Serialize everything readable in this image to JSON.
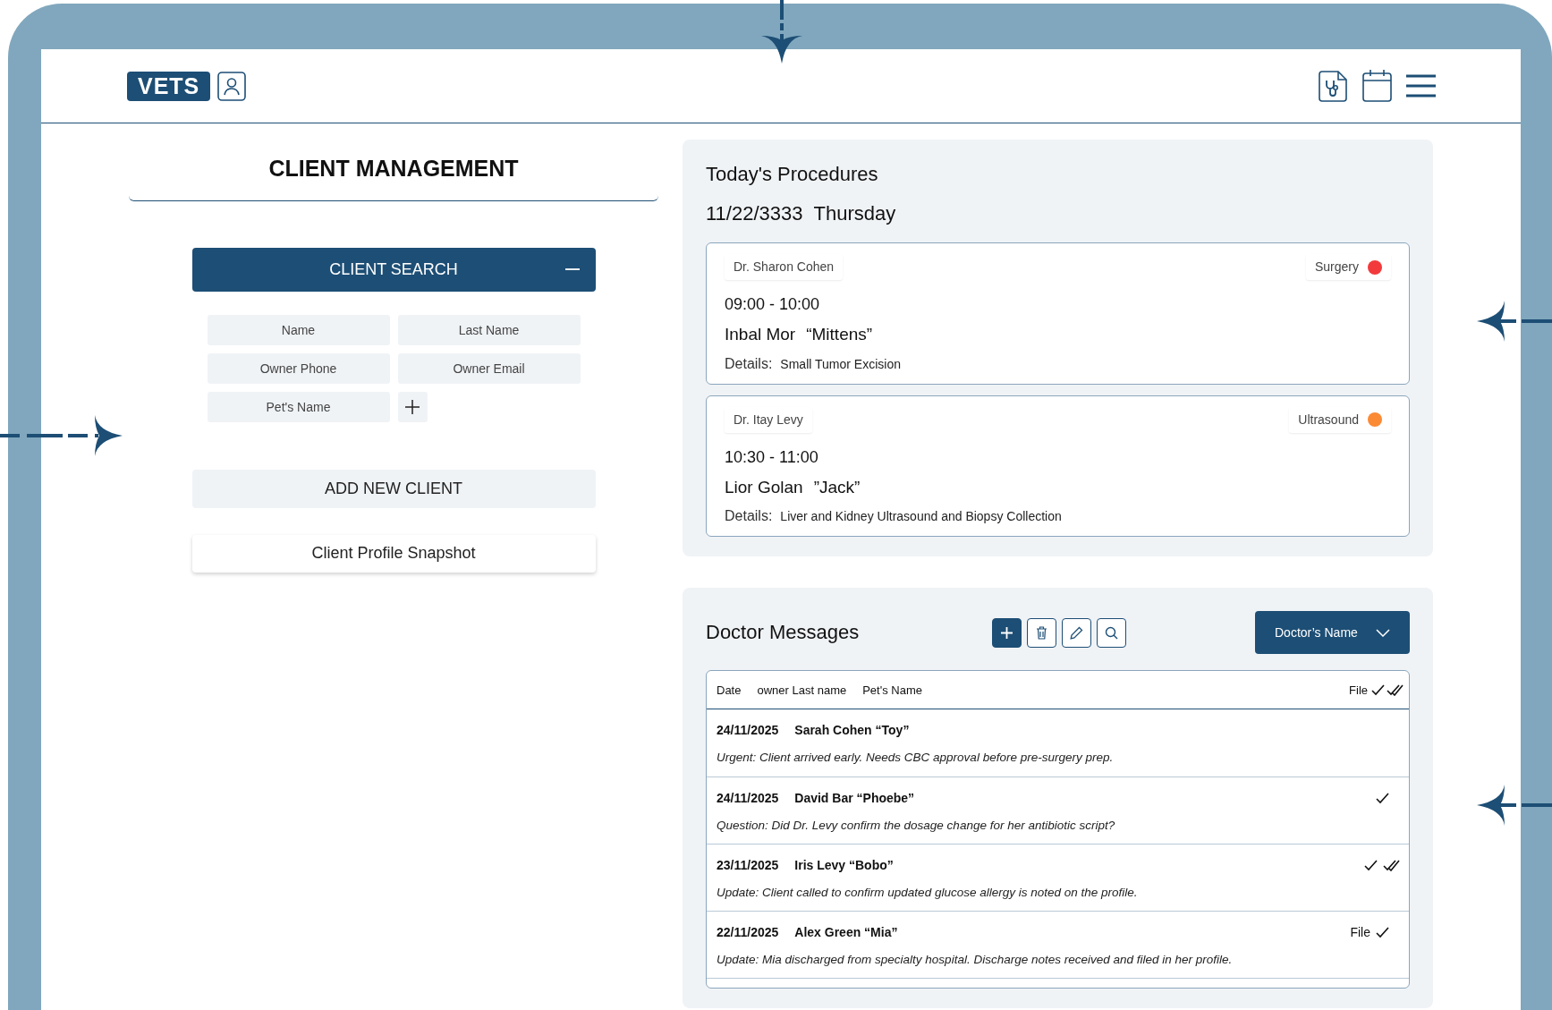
{
  "header": {
    "logo": "VETS"
  },
  "client_management": {
    "title": "CLIENT MANAGEMENT",
    "search": {
      "title": "CLIENT SEARCH",
      "expanded": true,
      "fields": [
        {
          "placeholder": "Name"
        },
        {
          "placeholder": "Last Name"
        },
        {
          "placeholder": "Owner Phone"
        },
        {
          "placeholder": "Owner Email"
        },
        {
          "placeholder": "Pet's Name"
        }
      ]
    },
    "add_button": "ADD NEW CLIENT",
    "snapshot": "Client Profile Snapshot"
  },
  "procedures": {
    "title": "Today's Procedures",
    "date": "11/22/3333",
    "weekday": "Thursday",
    "items": [
      {
        "doctor": "Dr. Sharon Cohen",
        "type": "Surgery",
        "color": "#f23a3c",
        "time": "09:00 - 10:00",
        "owner": "Inbal Mor",
        "pet": "“Mittens”",
        "details_label": "Details:",
        "details": "Small Tumor Excision"
      },
      {
        "doctor": "Dr. Itay Levy",
        "type": "Ultrasound",
        "color": "#fb8a35",
        "time": "10:30 - 11:00",
        "owner": "Lior Golan",
        "pet": "”Jack”",
        "details_label": "Details:",
        "details": "Liver and Kidney Ultrasound and Biopsy Collection"
      }
    ]
  },
  "messages": {
    "title": "Doctor Messages",
    "filter": "Doctor’s Name",
    "columns": [
      "Date",
      "owner Last name",
      "Pet's Name"
    ],
    "file_column": "File",
    "rows": [
      {
        "date": "24/11/2025",
        "name": "Sarah Cohen “Toy”",
        "text": "Urgent: Client arrived early. Needs CBC approval before pre-surgery prep.",
        "sent": false,
        "read": false
      },
      {
        "date": "24/11/2025",
        "name": "David Bar “Phoebe”",
        "text": "Question: Did Dr. Levy confirm the dosage change for her antibiotic script?",
        "sent": true,
        "read": false
      },
      {
        "date": "23/11/2025",
        "name": "Iris Levy “Bobo”",
        "text": "Update: Client called to confirm updated glucose allergy is noted on the profile.",
        "sent": true,
        "read": true
      },
      {
        "date": "22/11/2025",
        "name": "Alex Green “Mia”",
        "file": "File",
        "text": "Update: Mia discharged from specialty hospital. Discharge notes received and filed in her profile.",
        "sent": true,
        "read": false
      }
    ]
  }
}
